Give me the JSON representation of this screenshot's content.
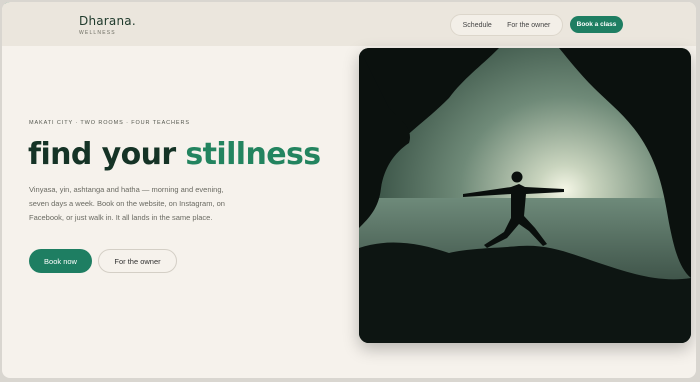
{
  "brand": {
    "name": "Dharana.",
    "tagline": "WELLNESS"
  },
  "nav": {
    "items": [
      {
        "label": "Schedule"
      },
      {
        "label": "For the owner"
      }
    ],
    "cta": "Book a class"
  },
  "hero": {
    "eyebrow": "MAKATI CITY · TWO ROOMS · FOUR TEACHERS",
    "title_main": "find your",
    "title_accent": "stillness",
    "description": "Vinyasa, yin, ashtanga and hatha — morning and evening, seven days a week. Book on the website, on Instagram, on Facebook, or just walk in. It all lands in the same place.",
    "primary_button": "Book now",
    "secondary_button": "For the owner"
  },
  "colors": {
    "accent": "#1e7e62",
    "heading": "#153326",
    "page_bg": "#f6f2ec",
    "header_bg": "#ebe6dd"
  },
  "image": {
    "icon": "yoga-warrior-cave-photo"
  }
}
